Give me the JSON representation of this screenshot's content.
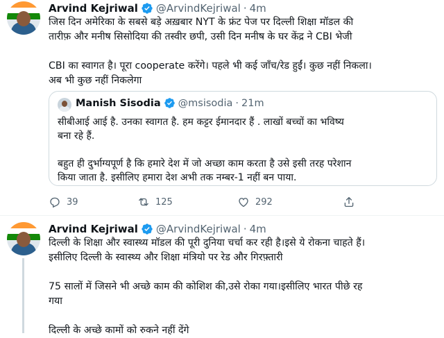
{
  "tweet1": {
    "name": "Arvind Kejriwal",
    "handle": "@ArvindKejriwal",
    "dot": "·",
    "time": "4m",
    "text": "जिस दिन अमेरिका के सबसे बड़े अख़बार NYT के फ्रंट पेज पर दिल्ली शिक्षा मॉडल की\nतारीफ़ और मनीष सिसोदिया की तस्वीर छपी, उसी दिन मनीष के घर केंद्र ने CBI भेजी\n\nCBI का स्वागत है। पूरा cooperate करेंगे। पहले भी कई जाँच/रेड हुईं। कुछ नहीं निकला।\nअब भी कुछ नहीं निकलेगा",
    "quote": {
      "name": "Manish Sisodia",
      "handle": "@msisodia",
      "dot": "·",
      "time": "21m",
      "text": "सीबीआई आई है. उनका स्वागत है. हम कट्टर ईमानदार हैं . लाखों बच्चों का भविष्य\nबना रहे हैं.\n\nबहुत ही दुर्भाग्यपूर्ण है कि हमारे देश में जो अच्छा काम करता है उसे इसी तरह परेशान\nकिया जाता है. इसीलिए हमारा देश अभी तक नम्बर-1 नहीं बन पाया."
    },
    "actions": {
      "reply_count": "39",
      "retweet_count": "125",
      "like_count": "292"
    }
  },
  "tweet2": {
    "name": "Arvind Kejriwal",
    "handle": "@ArvindKejriwal",
    "dot": "·",
    "time": "4m",
    "text": "दिल्ली के शिक्षा और स्वास्थ्य मॉडल की पूरी दुनिया चर्चा कर रही है।इसे ये रोकना चाहते हैं।\nइसीलिए दिल्ली के स्वास्थ्य और शिक्षा मंत्रियो पर रेड और गिरफ़्तारी\n\n75 सालों में जिसने भी अच्छे काम की कोशिश की,उसे रोका गया।इसीलिए भारत पीछे रह\nगया\n\nदिल्ली के अच्छे कामों को रुकने नहीं देंगे"
  },
  "colors": {
    "verified": "#1d9bf0",
    "secondary": "#536471",
    "border": "#cfd9de"
  },
  "icons": [
    "reply-icon",
    "retweet-icon",
    "like-icon",
    "share-icon",
    "verified-badge-icon"
  ]
}
